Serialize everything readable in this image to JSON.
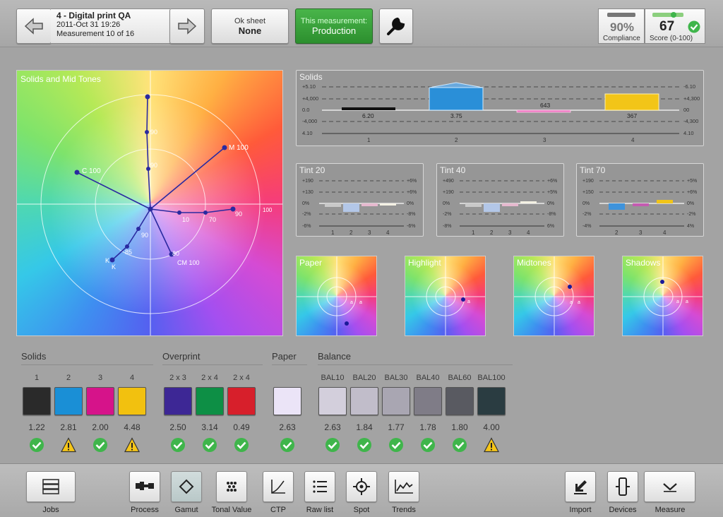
{
  "header": {
    "job_title": "4 - Digital print QA",
    "job_date": "2011-Oct 31 19:26",
    "job_measurement": "Measurement 10 of 16",
    "ok_sheet_label": "Ok sheet",
    "ok_sheet_value": "None",
    "this_measurement_label": "This measurement:",
    "this_measurement_value": "Production",
    "compliance_value": "90%",
    "compliance_label": "Compliance",
    "score_value": "67",
    "score_label": "Score (0-100)"
  },
  "gamut": {
    "title": "Solids and Mid Tones",
    "labels": {
      "m100": "M 100",
      "c100": "C 100",
      "cm100": "CM 100",
      "k": "K",
      "k2": "K",
      "v100": "100",
      "v90a": "90",
      "v90b": "90",
      "v70": "70",
      "v10": "10",
      "v85": "85",
      "v90c": "90",
      "v80": "80",
      "v90d": "90"
    }
  },
  "solids_chart": {
    "title": "Solids",
    "left_ticks": [
      "+5.10",
      "+4,000",
      "0.0",
      "-4,000",
      "4.10"
    ],
    "right_ticks": [
      "-6.10",
      "+4,300",
      "00",
      "-4,300",
      "4.10"
    ],
    "value_labels": [
      "6.20",
      "3.75",
      "643",
      "367"
    ],
    "x_labels": [
      "1",
      "2",
      "3",
      "4"
    ]
  },
  "tints": [
    {
      "title": "Tint 20",
      "left": [
        "+190",
        "+130",
        "0%",
        "-2%",
        "-6%"
      ],
      "right": [
        "+6%",
        "+6%",
        "0%",
        "-8%",
        "-6%"
      ],
      "x": [
        "1",
        "2",
        "3",
        "4"
      ]
    },
    {
      "title": "Tint 40",
      "left": [
        "+490",
        "+190",
        "0%",
        "-2%",
        "-8%"
      ],
      "right": [
        "+6%",
        "+5%",
        "0%",
        "-8%",
        "6%"
      ],
      "x": [
        "1",
        "2",
        "3",
        "4"
      ]
    },
    {
      "title": "Tint 70",
      "left": [
        "+190",
        "+150",
        "0%",
        "-2%",
        "-4%"
      ],
      "right": [
        "+5%",
        "+6%",
        "0%",
        "-2%",
        "4%"
      ],
      "x": [
        "2",
        "3",
        "4"
      ]
    }
  ],
  "minis": [
    {
      "title": "Paper",
      "a1": "a",
      "a2": "a"
    },
    {
      "title": "Highlight",
      "a1": "a"
    },
    {
      "title": "Midtones",
      "a1": "a",
      "a2": "a"
    },
    {
      "title": "Shadows",
      "a1": "a",
      "a2": "a"
    }
  ],
  "sections": {
    "solids": "Solids",
    "overprint": "Overprint",
    "paper": "Paper",
    "balance": "Balance"
  },
  "swatches": [
    {
      "label": "1",
      "value": "1.22",
      "color": "#2a2a2a",
      "status": "ok"
    },
    {
      "label": "2",
      "value": "2.81",
      "color": "#1a8fd6",
      "status": "warn"
    },
    {
      "label": "3",
      "value": "2.00",
      "color": "#d6138a",
      "status": "ok"
    },
    {
      "label": "4",
      "value": "4.48",
      "color": "#f2c10f",
      "status": "warn"
    },
    {
      "label": "2 x 3",
      "value": "2.50",
      "color": "#3d2795",
      "status": "ok"
    },
    {
      "label": "2 x 4",
      "value": "3.14",
      "color": "#0d8f45",
      "status": "ok"
    },
    {
      "label": "2 x 4",
      "value": "0.49",
      "color": "#d71f2b",
      "status": "ok"
    },
    {
      "label": "",
      "value": "2.63",
      "color": "#ebe4f7",
      "status": "ok"
    },
    {
      "label": "BAL10",
      "value": "2.63",
      "color": "#d3cfdc",
      "status": "ok"
    },
    {
      "label": "BAL20",
      "value": "1.84",
      "color": "#c1bdca",
      "status": "ok"
    },
    {
      "label": "BAL30",
      "value": "1.77",
      "color": "#a9a6b2",
      "status": "ok"
    },
    {
      "label": "BAL40",
      "value": "1.78",
      "color": "#7f7c87",
      "status": "ok"
    },
    {
      "label": "BAL60",
      "value": "1.80",
      "color": "#595a61",
      "status": "ok"
    },
    {
      "label": "BAL100",
      "value": "4.00",
      "color": "#2a3c41",
      "status": "warn"
    }
  ],
  "toolbar": {
    "jobs": "Jobs",
    "process": "Process",
    "gamut": "Gamut",
    "tonal_value": "Tonal Value",
    "ctp": "CTP",
    "raw_list": "Raw list",
    "spot": "Spot",
    "trends": "Trends",
    "import": "Import",
    "devices": "Devices",
    "measure": "Measure"
  },
  "colors": {
    "accent_green": "#2c8f2e",
    "ok_green": "#3fb54b",
    "warn_yellow": "#f5c518"
  }
}
